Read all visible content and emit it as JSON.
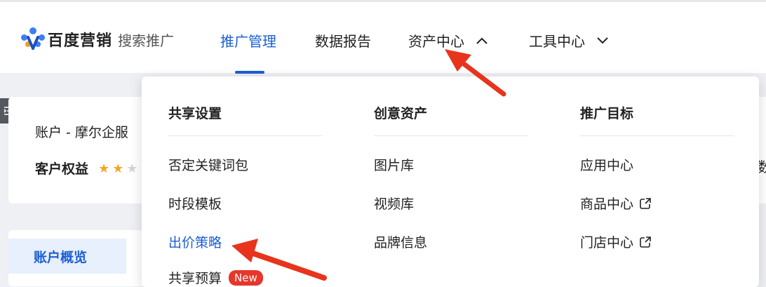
{
  "header": {
    "logo_text": "百度营销",
    "logo_sub": "搜索推广",
    "nav": [
      {
        "label": "推广管理"
      },
      {
        "label": "数据报告"
      },
      {
        "label": "资产中心"
      },
      {
        "label": "工具中心"
      }
    ]
  },
  "sidebar": {
    "account_label": "账户 - 摩尔企服",
    "rights_label": "客户权益",
    "rights_stars": 2,
    "overview_label": "账户概览"
  },
  "right_edge_text": "数",
  "dropdown": {
    "columns": [
      {
        "title": "共享设置",
        "items": [
          {
            "label": "否定关键词包"
          },
          {
            "label": "时段模板"
          },
          {
            "label": "出价策略"
          },
          {
            "label": "共享预算",
            "badge": "New"
          }
        ]
      },
      {
        "title": "创意资产",
        "items": [
          {
            "label": "图片库"
          },
          {
            "label": "视频库"
          },
          {
            "label": "品牌信息"
          }
        ]
      },
      {
        "title": "推广目标",
        "items": [
          {
            "label": "应用中心"
          },
          {
            "label": "商品中心"
          },
          {
            "label": "门店中心"
          }
        ]
      }
    ]
  },
  "colors": {
    "accent": "#1b5fd6",
    "badge": "#e5372c",
    "annotation_arrow": "#e8341c",
    "star": "#f5a623"
  }
}
